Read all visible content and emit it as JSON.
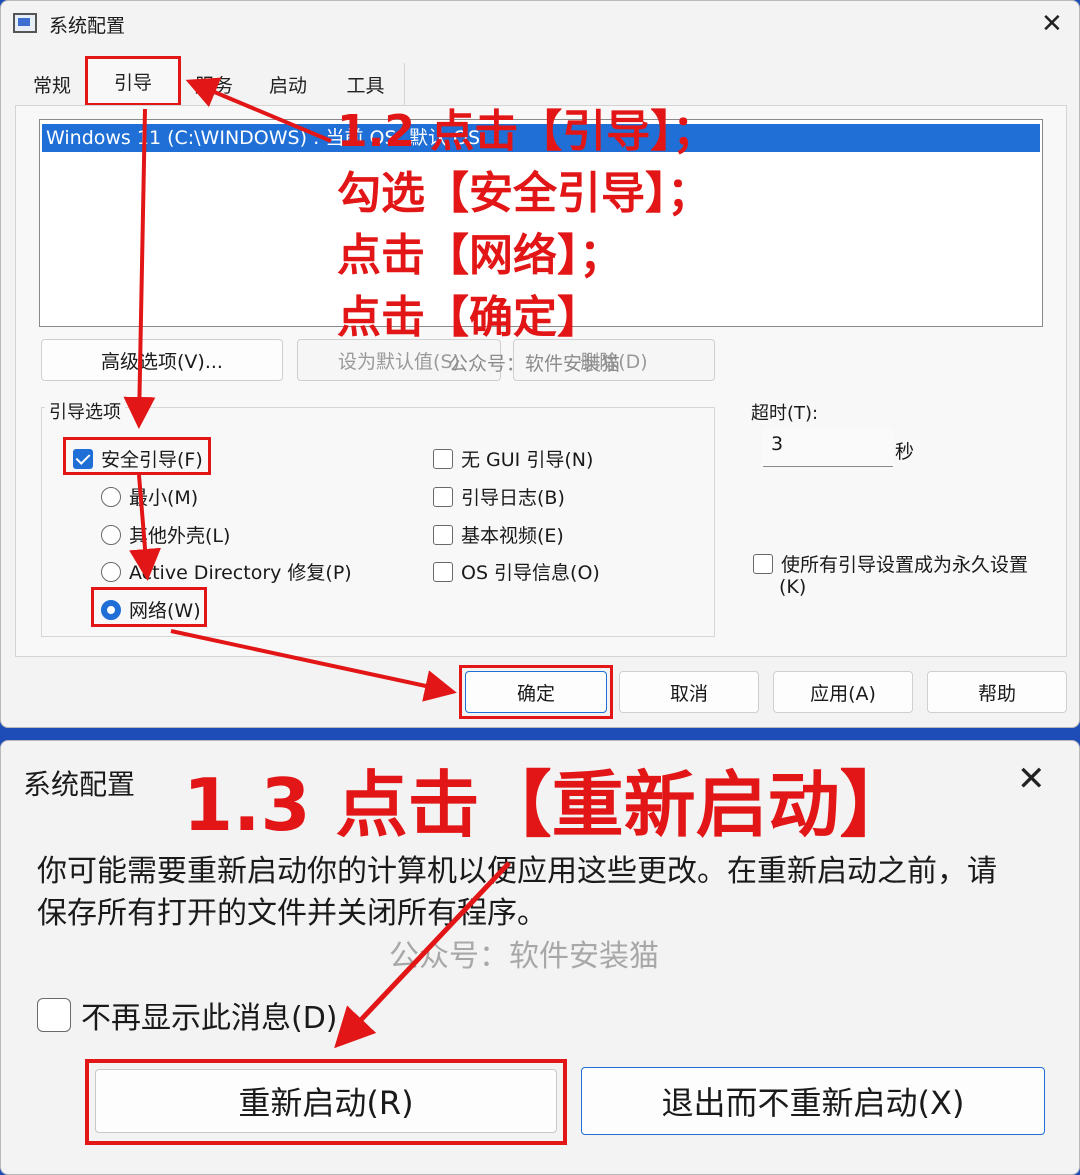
{
  "dialog1": {
    "title": "系统配置",
    "tabs": [
      "常规",
      "引导",
      "服务",
      "启动",
      "工具"
    ],
    "os_entry": "Windows 11 (C:\\WINDOWS) : 当前 OS; 默认 OS",
    "buttons": {
      "advanced": "高级选项(V)...",
      "set_default": "设为默认值(S)",
      "delete": "删除(D)",
      "ok": "确定",
      "cancel": "取消",
      "apply": "应用(A)",
      "help": "帮助"
    },
    "boot_options_label": "引导选项",
    "safe_boot": "安全引导(F)",
    "minimal": "最小(M)",
    "alternate_shell": "其他外壳(L)",
    "ad_repair": "Active Directory 修复(P)",
    "network": "网络(W)",
    "no_gui": "无 GUI 引导(N)",
    "boot_log": "引导日志(B)",
    "base_video": "基本视频(E)",
    "os_boot_info": "OS 引导信息(O)",
    "timeout_label": "超时(T):",
    "timeout_value": "3",
    "timeout_unit": "秒",
    "make_permanent": "使所有引导设置成为永久设置",
    "make_permanent_key": "(K)",
    "watermark": "公众号：软件安装猫",
    "annotation": [
      "1.2 点击【引导】；",
      "勾选【安全引导】；",
      "点击【网络】；",
      "点击【确定】"
    ]
  },
  "dialog2": {
    "title": "系统配置",
    "annotation": "1.3 点击【重新启动】",
    "message_line1": "你可能需要重新启动你的计算机以便应用这些更改。在重新启动之前，请",
    "message_line2": "保存所有打开的文件并关闭所有程序。",
    "watermark": "公众号：软件安装猫",
    "dont_show": "不再显示此消息(D)",
    "restart": "重新启动(R)",
    "exit_no_restart": "退出而不重新启动(X)"
  },
  "colors": {
    "accent": "#1f6fd6",
    "annotation_red": "#e21616",
    "background": "#1f4db8"
  },
  "state": {
    "selected_tab": "引导",
    "safe_boot_checked": true,
    "network_selected": true
  }
}
